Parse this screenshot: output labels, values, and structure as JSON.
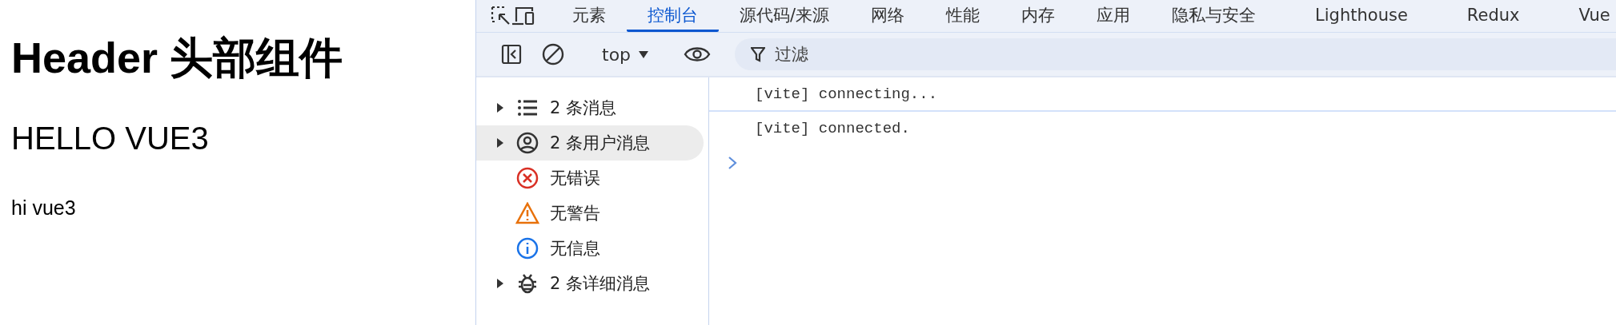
{
  "page": {
    "heading": "Header 头部组件",
    "subheading": "HELLO VUE3",
    "text": "hi vue3"
  },
  "devtools": {
    "tabs": [
      {
        "label": "元素",
        "selected": false
      },
      {
        "label": "控制台",
        "selected": true
      },
      {
        "label": "源代码/来源",
        "selected": false
      },
      {
        "label": "网络",
        "selected": false
      },
      {
        "label": "性能",
        "selected": false
      },
      {
        "label": "内存",
        "selected": false
      },
      {
        "label": "应用",
        "selected": false
      },
      {
        "label": "隐私与安全",
        "selected": false
      },
      {
        "label": "Lighthouse",
        "selected": false
      },
      {
        "label": "Redux",
        "selected": false
      },
      {
        "label": "Vue",
        "selected": false
      }
    ],
    "toolbar": {
      "context": "top",
      "filter_placeholder": "过滤"
    },
    "sidebar": [
      {
        "kind": "list",
        "label": "2 条消息",
        "collapsible": true,
        "selected": false
      },
      {
        "kind": "user",
        "label": "2 条用户消息",
        "collapsible": true,
        "selected": true
      },
      {
        "kind": "error",
        "label": "无错误",
        "collapsible": false,
        "selected": false
      },
      {
        "kind": "warning",
        "label": "无警告",
        "collapsible": false,
        "selected": false
      },
      {
        "kind": "info",
        "label": "无信息",
        "collapsible": false,
        "selected": false
      },
      {
        "kind": "bug",
        "label": "2 条详细消息",
        "collapsible": true,
        "selected": false
      }
    ],
    "messages": [
      "[vite] connecting...",
      "[vite] connected."
    ]
  }
}
